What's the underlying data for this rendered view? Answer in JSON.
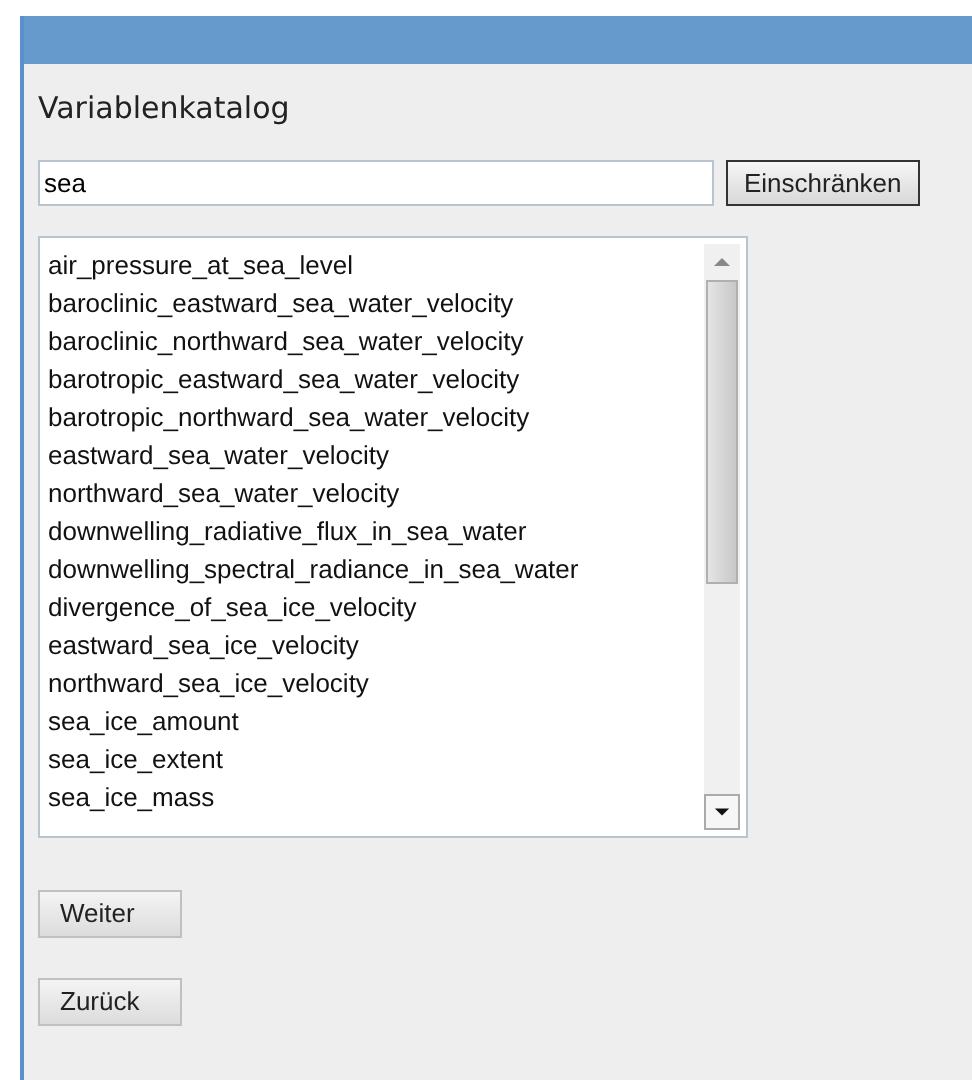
{
  "title": "Variablenkatalog",
  "search": {
    "value": "sea",
    "button": "Einschränken"
  },
  "variables": [
    "air_pressure_at_sea_level",
    "baroclinic_eastward_sea_water_velocity",
    "baroclinic_northward_sea_water_velocity",
    "barotropic_eastward_sea_water_velocity",
    "barotropic_northward_sea_water_velocity",
    "eastward_sea_water_velocity",
    "northward_sea_water_velocity",
    "downwelling_radiative_flux_in_sea_water",
    "downwelling_spectral_radiance_in_sea_water",
    "divergence_of_sea_ice_velocity",
    "eastward_sea_ice_velocity",
    "northward_sea_ice_velocity",
    "sea_ice_amount",
    "sea_ice_extent",
    "sea_ice_mass"
  ],
  "buttons": [
    "Weiter",
    "Zurück"
  ]
}
